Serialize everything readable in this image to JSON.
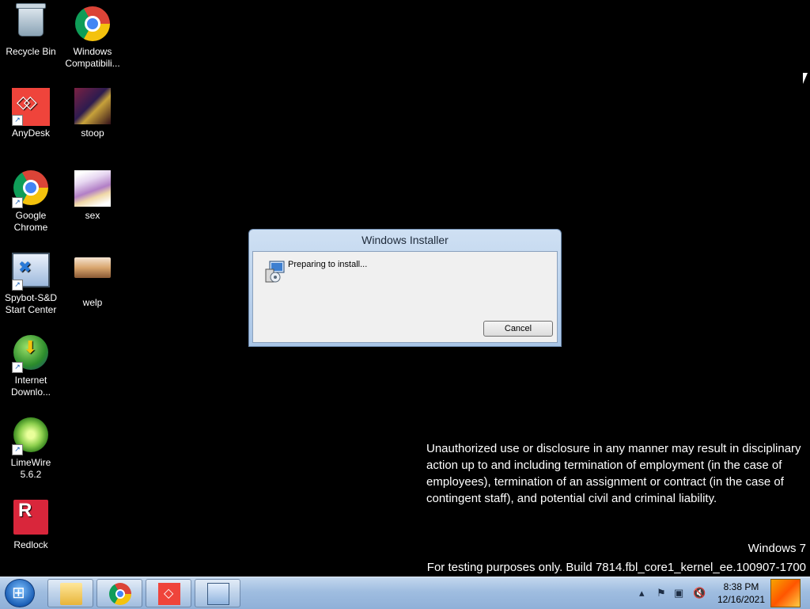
{
  "desktop": {
    "icons": [
      {
        "label": "Recycle Bin"
      },
      {
        "label": "Windows Compatibili..."
      },
      {
        "label": "AnyDesk"
      },
      {
        "label": "stoop"
      },
      {
        "label": "Google Chrome"
      },
      {
        "label": "sex"
      },
      {
        "label": "Spybot-S&D Start Center"
      },
      {
        "label": "welp"
      },
      {
        "label": "Internet Downlo..."
      },
      {
        "label": "LimeWire 5.6.2"
      },
      {
        "label": "Redlock"
      }
    ]
  },
  "dialog": {
    "title": "Windows Installer",
    "message": "Preparing to install...",
    "cancel_label": "Cancel"
  },
  "notice": {
    "text": "Unauthorized use or disclosure in any manner may result in disciplinary action up to and including termination of employment (in the case of employees), termination of an assignment or contract (in the case of contingent staff), and potential civil and criminal liability."
  },
  "watermark": {
    "os": "Windows 7",
    "build": "For testing purposes only. Build 7814.fbl_core1_kernel_ee.100907-1700"
  },
  "taskbar": {
    "clock_time": "8:38 PM",
    "clock_date": "12/16/2021"
  }
}
